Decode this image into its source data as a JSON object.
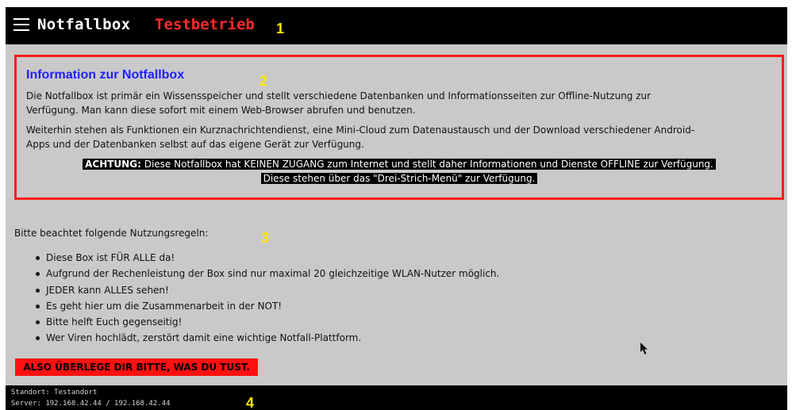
{
  "header": {
    "menu_icon": "hamburger-menu-icon",
    "title": "Notfallbox",
    "mode": "Testbetrieb",
    "marker": "1"
  },
  "info": {
    "title": "Information zur Notfallbox",
    "marker": "2",
    "paragraph1_line1": "Die Notfallbox ist primär ein Wissensspeicher und stellt verschiedene Datenbanken und Informationsseiten zur Offline-Nutzung zur",
    "paragraph1_line2": "Verfügung. Man kann diese sofort mit einem Web-Browser abrufen und benutzen.",
    "paragraph2_line1": "Weiterhin stehen als Funktionen ein Kurznachrichtendienst, eine Mini-Cloud zum Datenaustausch und der Download verschiedener Android-",
    "paragraph2_line2": "Apps und der Datenbanken selbst auf das eigene Gerät zur Verfügung.",
    "notice_label": "ACHTUNG:",
    "notice_text": "Diese Notfallbox hat KEINEN ZUGANG zum Internet und stellt daher Informationen und Dienste OFFLINE zur Verfügung.",
    "notice_line2": "Diese stehen über das \"Drei-Strich-Menü\" zur Verfügung."
  },
  "rules": {
    "intro": "Bitte beachtet folgende Nutzungsregeln:",
    "marker": "3",
    "items": [
      "Diese Box ist FÜR ALLE da!",
      "Aufgrund der Rechenleistung der Box sind nur maximal 20 gleichzeitige WLAN-Nutzer möglich.",
      "JEDER kann ALLES sehen!",
      "Es geht hier um die Zusammenarbeit in der NOT!",
      "Bitte helft Euch gegenseitig!",
      "Wer Viren hochlädt, zerstört damit eine wichtige Notfall-Plattform."
    ],
    "warning": "ALSO ÜBERLEGE DIR BITTE, WAS DU TUST."
  },
  "footer": {
    "standort": "Standort: Testandort",
    "server": "Server: 192.168.42.44 / 192.168.42.44",
    "marker": "4"
  },
  "colors": {
    "bar": "#000000",
    "background": "#c9c9c9",
    "accent_red": "#ff1a1a",
    "title_blue": "#1f1fff",
    "marker_yellow": "#ffe600"
  }
}
